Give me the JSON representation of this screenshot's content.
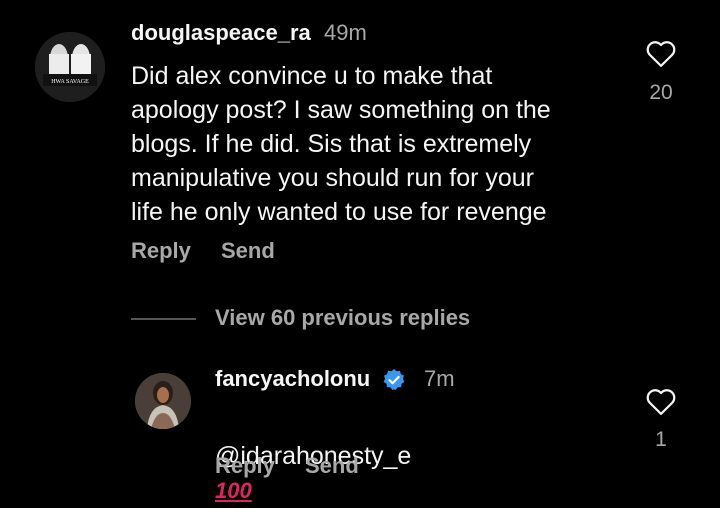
{
  "comment1": {
    "username": "douglaspeace_ra",
    "time": "49m",
    "text": "Did alex convince u to make that\napology post? I saw something on the\nblogs. If he did. Sis that is extremely\nmanipulative you should run for your\nlife he only wanted to use for revenge",
    "reply_label": "Reply",
    "send_label": "Send",
    "like_count": "20",
    "avatar_text": "HWA SAVAGE"
  },
  "view_replies_label": "View 60 previous replies",
  "comment2": {
    "username": "fancyacholonu",
    "time": "7m",
    "text_mention": "@idarahonesty_e",
    "text_emoji": "100",
    "reply_label": "Reply",
    "send_label": "Send",
    "like_count": "1"
  },
  "colors": {
    "background": "#000000",
    "secondary_text": "#a8a8a8",
    "verified_badge": "#3897f0",
    "emoji_red": "#e0245e"
  }
}
